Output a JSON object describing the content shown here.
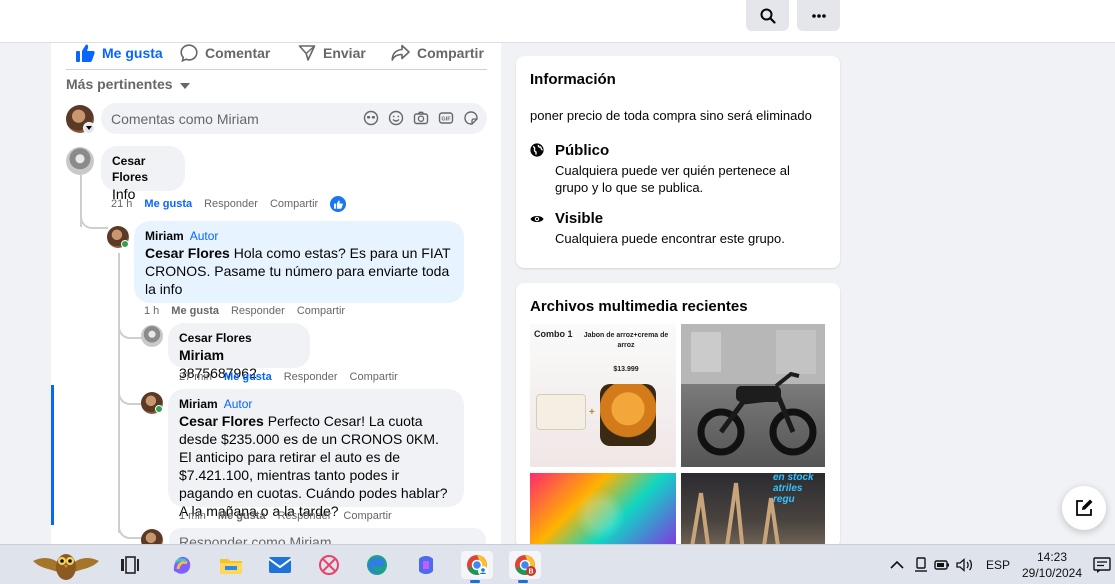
{
  "post_actions": {
    "like": "Me gusta",
    "comment": "Comentar",
    "send": "Enviar",
    "share": "Compartir"
  },
  "sort_label": "Más pertinentes",
  "compose_placeholder": "Comentas como Miriam",
  "reply_placeholder": "Responder como Miriam",
  "comments": [
    {
      "author": "Cesar Flores",
      "text": "Info",
      "time": "21 h",
      "like": "Me gusta",
      "reply": "Responder",
      "share": "Compartir"
    },
    {
      "author": "Miriam",
      "badge": "Autor",
      "mention": "Cesar Flores",
      "text": "Hola como estas? Es para un FIAT CRONOS. Pasame tu número para enviarte toda la info",
      "time": "1 h",
      "like": "Me gusta",
      "reply": "Responder",
      "share": "Compartir"
    },
    {
      "author": "Cesar Flores",
      "mention": "Miriam",
      "text": "3875687962",
      "time": "27 min",
      "like": "Me gusta",
      "reply": "Responder",
      "share": "Compartir"
    },
    {
      "author": "Miriam",
      "badge": "Autor",
      "mention": "Cesar Flores",
      "text": "Perfecto Cesar! La cuota desde $235.000 es de un CRONOS 0KM. El anticipo para retirar el auto es de $7.421.100, mientras tanto podes ir pagando en cuotas. Cuándo podes hablar? A la mañana o a la tarde?",
      "time": "1 min",
      "like": "Me gusta",
      "reply": "Responder",
      "share": "Compartir"
    }
  ],
  "info_card": {
    "title": "Información",
    "description": "poner precio de toda compra sino será eliminado",
    "public_title": "Público",
    "public_text": "Cualquiera puede ver quién pertenece al grupo y lo que se publica.",
    "visible_title": "Visible",
    "visible_text": "Cualquiera puede encontrar este grupo."
  },
  "media_card": {
    "title": "Archivos multimedia recientes",
    "thumb1": {
      "label1": "Combo 1",
      "label2": "Jabon de arroz+crema de arroz",
      "price": "$13.999"
    },
    "thumb4_text": "en stock atriles regu"
  },
  "taskbar": {
    "lang": "ESP",
    "time": "14:23",
    "date": "29/10/2024"
  },
  "colors": {
    "accent": "#0866ff",
    "secondary_text": "#65676b",
    "author_bubble": "#e7f3ff",
    "bubble": "#f0f2f5"
  },
  "icons": [
    "search-icon",
    "more-icon",
    "like-icon",
    "comment-icon",
    "send-icon",
    "share-icon",
    "edit-icon"
  ]
}
